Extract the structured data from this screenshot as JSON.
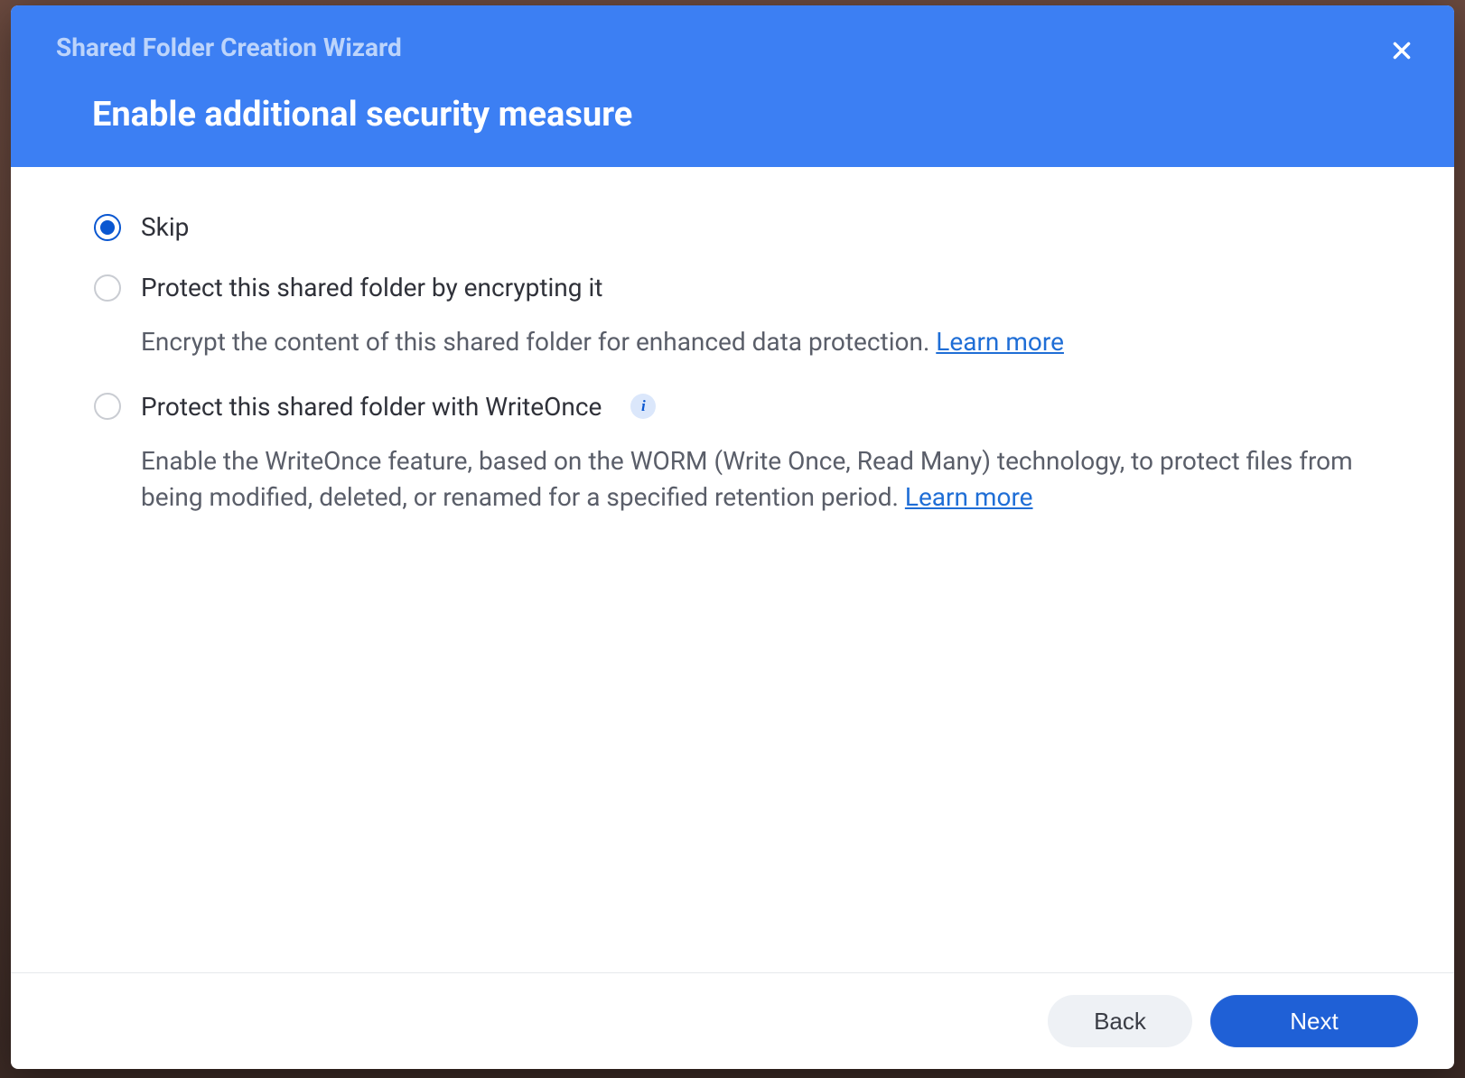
{
  "header": {
    "wizard_title": "Shared Folder Creation Wizard",
    "step_title": "Enable additional security measure"
  },
  "options": {
    "skip": {
      "label": "Skip"
    },
    "encrypt": {
      "label": "Protect this shared folder by encrypting it",
      "description": "Encrypt the content of this shared folder for enhanced data protection. ",
      "learn_more": "Learn more"
    },
    "writeonce": {
      "label": "Protect this shared folder with WriteOnce",
      "description": "Enable the WriteOnce feature, based on the WORM (Write Once, Read Many) technology, to protect files from being modified, deleted, or renamed for a specified retention period. ",
      "learn_more": "Learn more"
    }
  },
  "footer": {
    "back": "Back",
    "next": "Next"
  },
  "info_glyph": "i"
}
